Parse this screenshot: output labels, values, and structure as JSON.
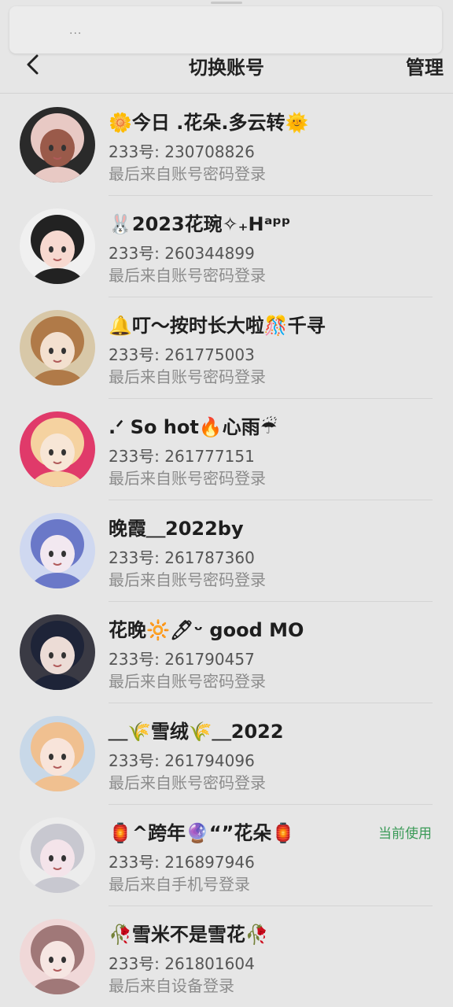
{
  "notification": {
    "dots": "..."
  },
  "header": {
    "title": "切换账号",
    "manage_label": "管理"
  },
  "accounts": [
    {
      "name": "🌼今日 .花朵.多云转🌞",
      "uid": "233号: 230708826",
      "login": "最后来自账号密码登录",
      "current": "",
      "avatar_colors": [
        "#2a2a2a",
        "#e8c9c4",
        "#9a5a4a"
      ]
    },
    {
      "name": "🐰2023花琬✧₊Hᵃᵖᵖ",
      "uid": "233号: 260344899",
      "login": "最后来自账号密码登录",
      "current": "",
      "avatar_colors": [
        "#f0f0f0",
        "#222222",
        "#f7d9d0"
      ]
    },
    {
      "name": "🔔叮～按时长大啦🎊千寻",
      "uid": "233号: 261775003",
      "login": "最后来自账号密码登录",
      "current": "",
      "avatar_colors": [
        "#d8c8a8",
        "#b07a48",
        "#f3e0cf"
      ]
    },
    {
      "name": ".ᐟ So hot🔥心雨☔",
      "uid": "233号: 261777151",
      "login": "最后来自账号密码登录",
      "current": "",
      "avatar_colors": [
        "#e03a6a",
        "#f5d2a0",
        "#f7e6d6"
      ]
    },
    {
      "name": "晚霞＿2022by",
      "uid": "233号: 261787360",
      "login": "最后来自账号密码登录",
      "current": "",
      "avatar_colors": [
        "#cfd8f0",
        "#6a78c8",
        "#f2e8f0"
      ]
    },
    {
      "name": "花晚🔆🖊ᵕ good MO",
      "uid": "233号: 261790457",
      "login": "最后来自账号密码登录",
      "current": "",
      "avatar_colors": [
        "#3a3a44",
        "#1e2438",
        "#ecdcd6"
      ]
    },
    {
      "name": "＿🌾雪绒🌾＿2022",
      "uid": "233号: 261794096",
      "login": "最后来自账号密码登录",
      "current": "",
      "avatar_colors": [
        "#c8d8e8",
        "#f0c090",
        "#f8e4da"
      ]
    },
    {
      "name": "🏮^跨年🔮“”花朵🏮",
      "uid": "233号: 216897946",
      "login": "最后来自手机号登录",
      "current": "当前使用",
      "avatar_colors": [
        "#ececec",
        "#c8c8d0",
        "#f4e4ea"
      ]
    },
    {
      "name": "🥀雪米不是雪花🥀",
      "uid": "233号: 261801604",
      "login": "最后来自设备登录",
      "current": "",
      "avatar_colors": [
        "#f0d8d8",
        "#a07878",
        "#f6e6e2"
      ]
    }
  ],
  "colors": {
    "background": "#e6e6e6",
    "current_badge": "#3a9a57",
    "secondary_text": "#8c8c8c"
  }
}
